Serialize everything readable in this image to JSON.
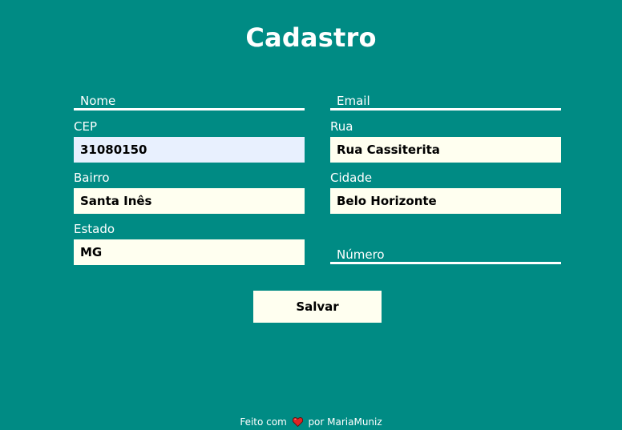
{
  "page": {
    "title": "Cadastro"
  },
  "form": {
    "nome": {
      "placeholder": "Nome",
      "value": ""
    },
    "email": {
      "placeholder": "Email",
      "value": ""
    },
    "cep": {
      "label": "CEP",
      "value": "31080150"
    },
    "rua": {
      "label": "Rua",
      "value": "Rua Cassiterita"
    },
    "bairro": {
      "label": "Bairro",
      "value": "Santa Inês"
    },
    "cidade": {
      "label": "Cidade",
      "value": "Belo Horizonte"
    },
    "estado": {
      "label": "Estado",
      "value": "MG"
    },
    "numero": {
      "placeholder": "Número",
      "value": ""
    },
    "save_label": "Salvar"
  },
  "footer": {
    "prefix": "Feito com",
    "icon": "heart-icon",
    "suffix": "por MariaMuniz"
  },
  "colors": {
    "background": "#008b84",
    "input_background": "#fffff0",
    "autofill_background": "#e8f0fe",
    "text": "#ffffff",
    "heart": "#e02424"
  }
}
